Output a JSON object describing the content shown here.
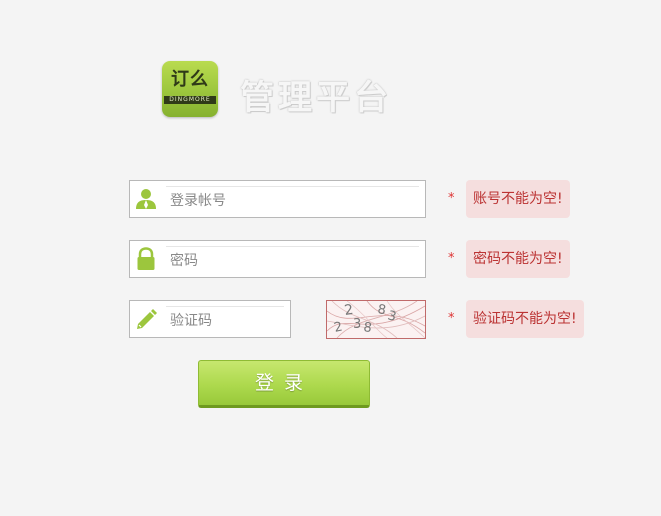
{
  "header": {
    "logo_main": "订么",
    "logo_sub": "DINGMORE",
    "title": "管理平台"
  },
  "form": {
    "account": {
      "placeholder": "登录帐号",
      "value": "",
      "icon": "user-icon"
    },
    "password": {
      "placeholder": "密码",
      "value": "",
      "icon": "lock-icon"
    },
    "captcha": {
      "placeholder": "验证码",
      "value": "",
      "icon": "pencil-icon",
      "image_text": "2 83 2 38"
    }
  },
  "errors": {
    "required_mark": "*",
    "account": "账号不能为空!",
    "password": "密码不能为空!",
    "captcha": "验证码不能为空!"
  },
  "actions": {
    "login_label": "登录"
  },
  "colors": {
    "brand_green": "#a9d64a",
    "error_bg": "#f5dede",
    "error_text": "#b33333"
  }
}
